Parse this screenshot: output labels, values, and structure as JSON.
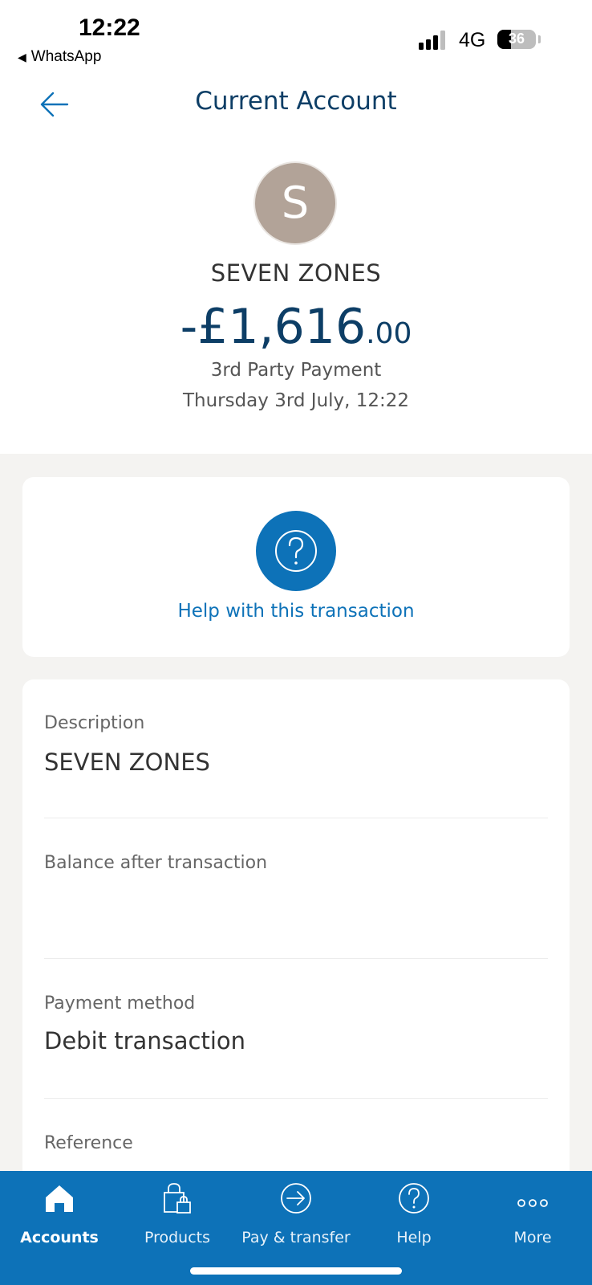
{
  "status_bar": {
    "time": "12:22",
    "back_app": "WhatsApp",
    "network": "4G",
    "battery": "36",
    "battery_level": 0.36
  },
  "header": {
    "title": "Current Account",
    "back_icon": "arrow-left-icon"
  },
  "transaction": {
    "avatar_letter": "S",
    "merchant": "SEVEN ZONES",
    "amount_main": "-£1,616",
    "amount_decimals": ".00",
    "type": "3rd Party Payment",
    "datetime": "Thursday 3rd July, 12:22"
  },
  "help": {
    "icon": "question-circle-icon",
    "label": "Help with this transaction"
  },
  "details": [
    {
      "label": "Description",
      "value": "SEVEN ZONES"
    },
    {
      "label": "Balance after transaction",
      "value": ""
    },
    {
      "label": "Payment method",
      "value": "Debit transaction"
    },
    {
      "label": "Reference",
      "value": ""
    }
  ],
  "bottom_nav": {
    "items": [
      {
        "label": "Accounts",
        "icon": "home-icon",
        "active": true
      },
      {
        "label": "Products",
        "icon": "shopping-bag-icon",
        "active": false
      },
      {
        "label": "Pay & transfer",
        "icon": "arrow-circle-icon",
        "active": false
      },
      {
        "label": "Help",
        "icon": "question-circle-icon",
        "active": false
      },
      {
        "label": "More",
        "icon": "more-dots-icon",
        "active": false
      }
    ]
  },
  "colors": {
    "brand_blue": "#0d72b8",
    "navy": "#0d3e66",
    "avatar_bg": "#b2a398",
    "background": "#f4f3f1"
  }
}
